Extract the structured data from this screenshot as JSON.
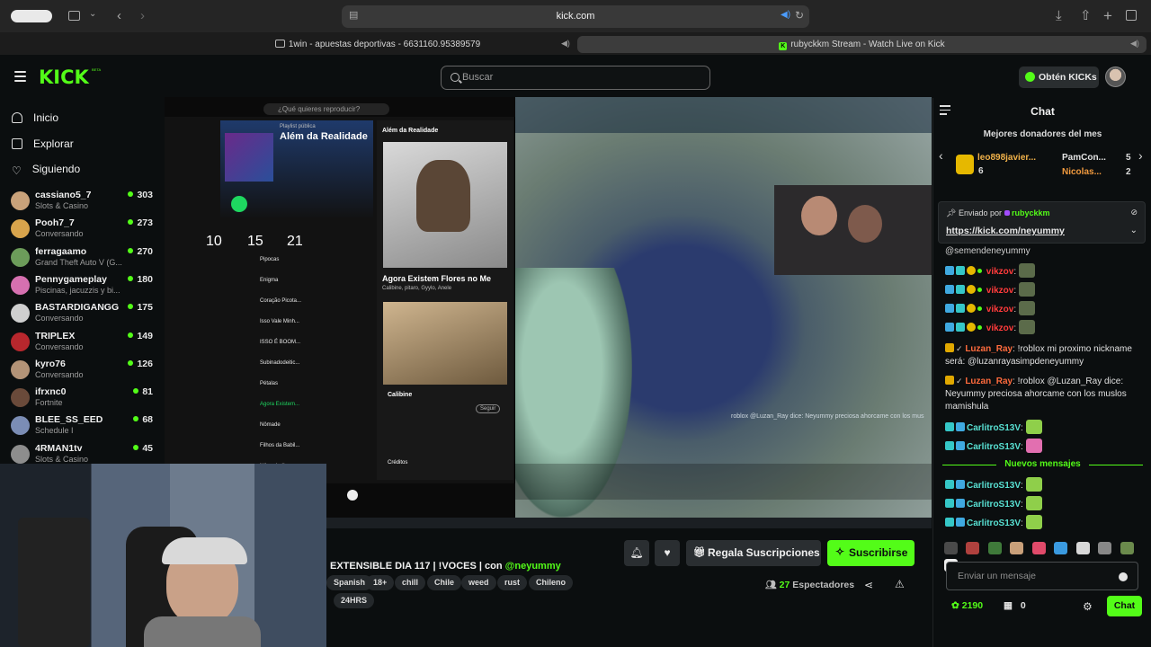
{
  "browser": {
    "url": "kick.com",
    "tab_left_title": "1win - apuestas deportivas - 6631160.95389579",
    "tab_right_title": "rubyckkm Stream - Watch Live on Kick"
  },
  "header": {
    "logo": "KICK",
    "logo_badge": "BETA",
    "search_placeholder": "Buscar",
    "get_kicks_label": "Obtén KICKs"
  },
  "sidebar": {
    "nav": [
      {
        "label": "Inicio",
        "icon": "home-icon"
      },
      {
        "label": "Explorar",
        "icon": "explore-icon"
      },
      {
        "label": "Siguiendo",
        "icon": "heart-icon"
      }
    ],
    "channels": [
      {
        "name": "cassiano5_7",
        "category": "Slots & Casino",
        "viewers": "303",
        "color": "#c9a27a"
      },
      {
        "name": "Pooh7_7",
        "category": "Conversando",
        "viewers": "273",
        "color": "#d8a44c"
      },
      {
        "name": "ferragaamo",
        "category": "Grand Theft Auto V (G...",
        "viewers": "270",
        "color": "#6c9c5a"
      },
      {
        "name": "Pennygameplay",
        "category": "Piscinas, jacuzzis y bi...",
        "viewers": "180",
        "color": "#d670b0"
      },
      {
        "name": "BASTARDIGANGG",
        "category": "Conversando",
        "viewers": "175",
        "color": "#cfcfcf"
      },
      {
        "name": "TRIPLEX",
        "category": "Conversando",
        "viewers": "149",
        "color": "#b8272d"
      },
      {
        "name": "kyro76",
        "category": "Conversando",
        "viewers": "126",
        "color": "#b39377"
      },
      {
        "name": "ifrxnc0",
        "category": "Fortnite",
        "viewers": "81",
        "color": "#6a4a3a"
      },
      {
        "name": "BLEE_SS_EED",
        "category": "Schedule I",
        "viewers": "68",
        "color": "#7b8db5"
      },
      {
        "name": "4RMAN1tv",
        "category": "Slots & Casino",
        "viewers": "45",
        "color": "#8d8d8d"
      }
    ]
  },
  "video": {
    "spotify": {
      "search_placeholder": "¿Qué quieres reproducir?",
      "playlist_label": "Playlist pública",
      "playlist_title": "Além da Realidade",
      "side_title": "Além da Realidade",
      "song_title": "Agora Existem Flores no Me",
      "song_artists": "Calibine, pitaro, Gyylo, Anele",
      "artist_name": "Calibine",
      "follow_label": "Seguir",
      "credits_label": "Créditos",
      "count_a": "10",
      "count_b": "15",
      "count_c": "21",
      "tracks": [
        "Pipocas",
        "Enigma",
        "Coração Picota...",
        "Isso Vale Minh...",
        "ISSO É BOOM...",
        "Subinadodeitic...",
        "Pétalas",
        "Agora Existem...",
        "Nômade",
        "Filhos da Babil...",
        "Nômade II"
      ]
    },
    "overlay_chat": "roblox @Luzan_Ray dice: Neyummy preciosa ahorcame con los mus"
  },
  "stream": {
    "title": "EXTENSIBLE DIA 117 | !VOCES | con",
    "mention": "@neyummy",
    "tags": [
      "Spanish",
      "18+",
      "chill",
      "Chile",
      "weed",
      "rust",
      "Chileno",
      "24HRS"
    ],
    "gift_label": "Regala Suscripciones",
    "subscribe_label": "Suscribirse",
    "viewer_count": "27",
    "viewers_label": "Espectadores"
  },
  "chat": {
    "title": "Chat",
    "donors_title": "Mejores donadores del mes",
    "donors": [
      {
        "name": "leo898javier...",
        "count": "6"
      },
      {
        "name": "PamCon...",
        "count": "5"
      },
      {
        "name": "Nicolas...",
        "count": "2"
      }
    ],
    "pinned_by_label": "Enviado por",
    "pinned_by_user": "rubyckkm",
    "pinned_link": "https://kick.com/neyummy",
    "partial_line": "@semendeneyummy",
    "messages": [
      {
        "user": "vikzov",
        "text": ":"
      },
      {
        "user": "vikzov",
        "text": ":"
      },
      {
        "user": "vikzov",
        "text": ":"
      },
      {
        "user": "vikzov",
        "text": ":"
      },
      {
        "user": "Luzan_Ray",
        "text": ": !roblox mi proximo nickname será: @luzanrayasimpdeneyummy"
      },
      {
        "user": "Luzan_Ray",
        "text": ": !roblox @Luzan_Ray dice: Neyummy preciosa ahorcame con los muslos mamishula"
      },
      {
        "user": "CarlitroS13V",
        "text": ":"
      },
      {
        "user": "CarlitroS13V",
        "text": ":"
      },
      {
        "user": "CarlitroS13V",
        "text": ":"
      },
      {
        "user": "CarlitroS13V",
        "text": ":"
      },
      {
        "user": "CarlitroS13V",
        "text": ":"
      }
    ],
    "new_messages_label": "Nuevos mensajes",
    "input_placeholder": "Enviar un mensaje",
    "points": "2190",
    "gift_count": "0",
    "send_label": "Chat"
  },
  "colors": {
    "brand": "#53fc18",
    "background": "#0b0e0f"
  }
}
